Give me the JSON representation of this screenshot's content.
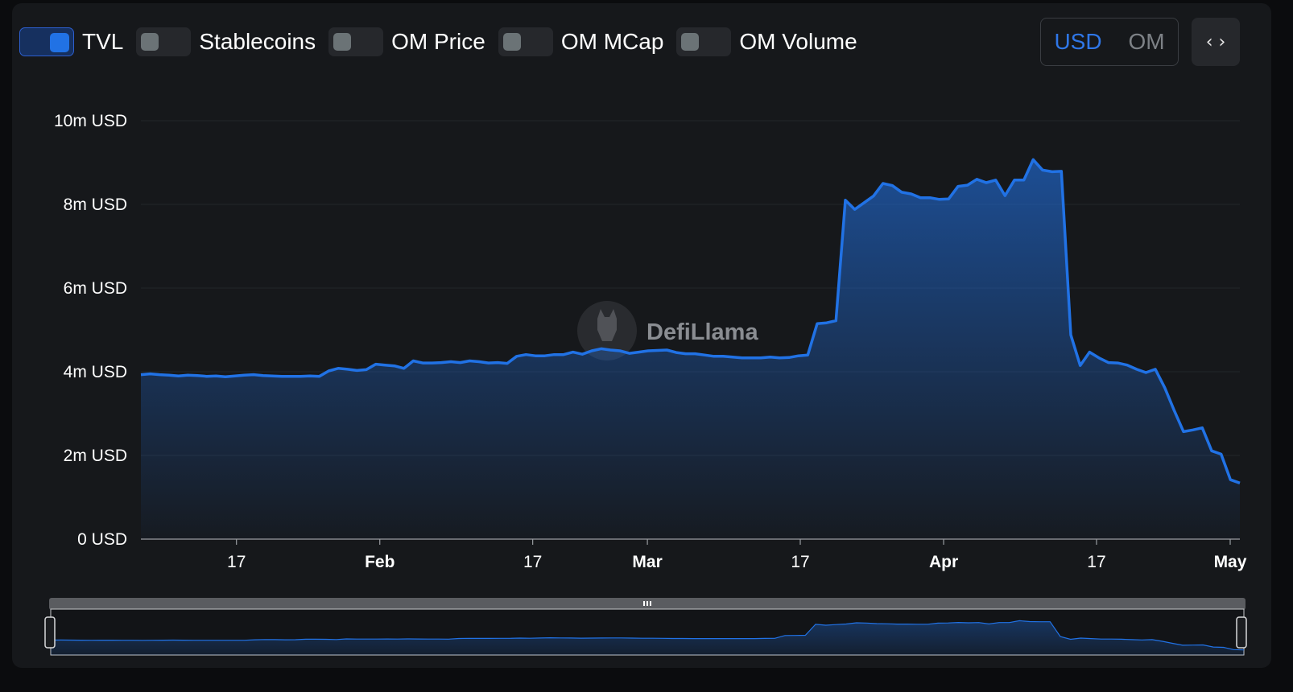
{
  "toggles": [
    {
      "label": "TVL",
      "on": true
    },
    {
      "label": "Stablecoins",
      "on": false
    },
    {
      "label": "OM Price",
      "on": false
    },
    {
      "label": "OM MCap",
      "on": false
    },
    {
      "label": "OM Volume",
      "on": false
    }
  ],
  "denomination": {
    "options": [
      "USD",
      "OM"
    ],
    "selected": "USD"
  },
  "embed_icon": "code-brackets-icon",
  "watermark": "DefiLlama",
  "colors": {
    "line": "#2172e5",
    "accent": "#2f77e8"
  },
  "chart_data": {
    "type": "area",
    "series": [
      {
        "name": "TVL",
        "unit": "USD"
      }
    ],
    "x_start": "2025-01-07",
    "x_end": "2025-05-02",
    "y_ticks": [
      "0 USD",
      "2m USD",
      "4m USD",
      "6m USD",
      "8m USD",
      "10m USD"
    ],
    "ylim": [
      0,
      10
    ],
    "y_unit": "m USD",
    "x_ticks": [
      {
        "label": "17",
        "date": "2025-01-17",
        "major": false
      },
      {
        "label": "Feb",
        "date": "2025-02-01",
        "major": true
      },
      {
        "label": "17",
        "date": "2025-02-17",
        "major": false
      },
      {
        "label": "Mar",
        "date": "2025-03-01",
        "major": true
      },
      {
        "label": "17",
        "date": "2025-03-17",
        "major": false
      },
      {
        "label": "Apr",
        "date": "2025-04-01",
        "major": true
      },
      {
        "label": "17",
        "date": "2025-04-17",
        "major": false
      },
      {
        "label": "May",
        "date": "2025-05-01",
        "major": true
      }
    ],
    "values": [
      3.93,
      3.95,
      3.93,
      3.92,
      3.9,
      3.92,
      3.91,
      3.89,
      3.9,
      3.88,
      3.9,
      3.92,
      3.93,
      3.91,
      3.9,
      3.89,
      3.89,
      3.89,
      3.9,
      3.89,
      4.02,
      4.08,
      4.06,
      4.03,
      4.05,
      4.18,
      4.16,
      4.14,
      4.08,
      4.26,
      4.21,
      4.21,
      4.22,
      4.24,
      4.22,
      4.26,
      4.24,
      4.21,
      4.22,
      4.2,
      4.37,
      4.41,
      4.38,
      4.38,
      4.41,
      4.41,
      4.47,
      4.42,
      4.5,
      4.55,
      4.52,
      4.5,
      4.44,
      4.47,
      4.5,
      4.51,
      4.52,
      4.46,
      4.43,
      4.43,
      4.4,
      4.37,
      4.37,
      4.35,
      4.33,
      4.33,
      4.33,
      4.35,
      4.33,
      4.34,
      4.38,
      4.4,
      5.15,
      5.17,
      5.22,
      8.1,
      7.88,
      8.04,
      8.2,
      8.5,
      8.45,
      8.29,
      8.25,
      8.16,
      8.16,
      8.12,
      8.13,
      8.43,
      8.46,
      8.6,
      8.52,
      8.58,
      8.21,
      8.58,
      8.58,
      9.07,
      8.82,
      8.78,
      8.79,
      4.88,
      4.15,
      4.47,
      4.33,
      4.22,
      4.21,
      4.16,
      4.06,
      3.98,
      4.06,
      3.62,
      3.08,
      2.57,
      2.61,
      2.66,
      2.11,
      2.03,
      1.42,
      1.34
    ]
  }
}
